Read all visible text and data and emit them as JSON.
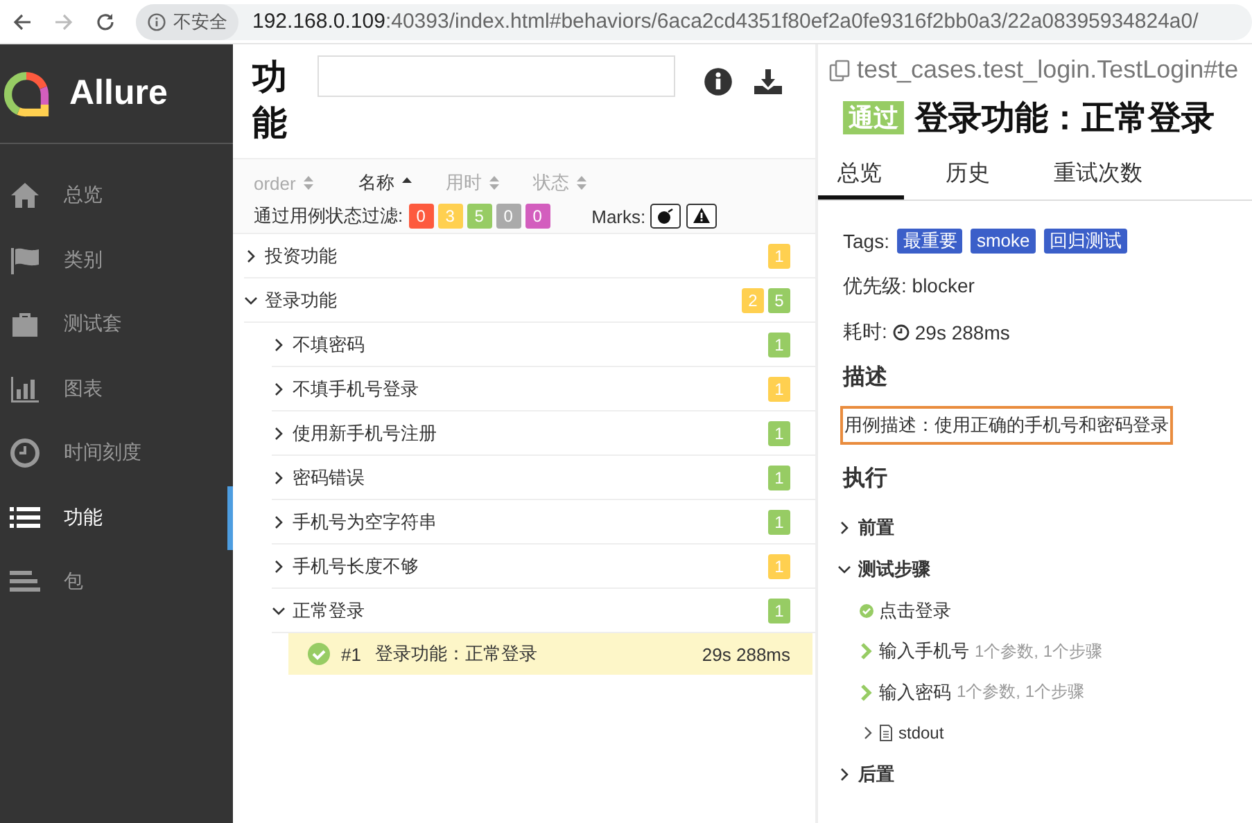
{
  "browser": {
    "security": "不安全",
    "url_host": "192.168.0.109",
    "url_rest": ":40393/index.html#behaviors/6aca2cd4351f80ef2a0fe9316f2bb0a3/22a08395934824a0/"
  },
  "sidebar": {
    "logo": "Allure",
    "items": [
      {
        "kind": "home",
        "label": "总览",
        "selected": false
      },
      {
        "kind": "flag",
        "label": "类别",
        "selected": false
      },
      {
        "kind": "briefcase",
        "label": "测试套",
        "selected": false
      },
      {
        "kind": "chart",
        "label": "图表",
        "selected": false
      },
      {
        "kind": "clock",
        "label": "时间刻度",
        "selected": false
      },
      {
        "kind": "list",
        "label": "功能",
        "selected": true
      },
      {
        "kind": "package",
        "label": "包",
        "selected": false
      }
    ]
  },
  "tree_panel": {
    "title": "功能",
    "sort_columns": [
      {
        "label": "order",
        "selected": false
      },
      {
        "label": "名称",
        "selected": true
      },
      {
        "label": "用时",
        "selected": false
      },
      {
        "label": "状态",
        "selected": false
      }
    ],
    "filter_label": "通过用例状态过滤:",
    "status_counts": [
      {
        "value": "0",
        "color": "#fd5a3e"
      },
      {
        "value": "3",
        "color": "#ffd050"
      },
      {
        "value": "5",
        "color": "#97cc64"
      },
      {
        "value": "0",
        "color": "#aaaaaa"
      },
      {
        "value": "0",
        "color": "#d35ebe"
      }
    ],
    "marks_label": "Marks:",
    "groups": [
      {
        "kind": "group",
        "label": "投资功能",
        "expanded": false,
        "counts": [
          {
            "value": "1",
            "color": "#ffd050"
          }
        ]
      },
      {
        "kind": "group",
        "label": "登录功能",
        "expanded": true,
        "counts": [
          {
            "value": "2",
            "color": "#ffd050"
          },
          {
            "value": "5",
            "color": "#97cc64"
          }
        ],
        "children": [
          {
            "kind": "group",
            "label": "不填密码",
            "expanded": false,
            "counts": [
              {
                "value": "1",
                "color": "#97cc64"
              }
            ]
          },
          {
            "kind": "group",
            "label": "不填手机号登录",
            "expanded": false,
            "counts": [
              {
                "value": "1",
                "color": "#ffd050"
              }
            ]
          },
          {
            "kind": "group",
            "label": "使用新手机号注册",
            "expanded": false,
            "counts": [
              {
                "value": "1",
                "color": "#97cc64"
              }
            ]
          },
          {
            "kind": "group",
            "label": "密码错误",
            "expanded": false,
            "counts": [
              {
                "value": "1",
                "color": "#97cc64"
              }
            ]
          },
          {
            "kind": "group",
            "label": "手机号为空字符串",
            "expanded": false,
            "counts": [
              {
                "value": "1",
                "color": "#97cc64"
              }
            ]
          },
          {
            "kind": "group",
            "label": "手机号长度不够",
            "expanded": false,
            "counts": [
              {
                "value": "1",
                "color": "#ffd050"
              }
            ]
          },
          {
            "kind": "group",
            "label": "正常登录",
            "expanded": true,
            "counts": [
              {
                "value": "1",
                "color": "#97cc64"
              }
            ],
            "children": [
              {
                "kind": "test",
                "number": "#1",
                "label": "登录功能：正常登录",
                "duration": "29s 288ms",
                "selected": true
              }
            ]
          }
        ]
      }
    ]
  },
  "detail": {
    "path": "test_cases.test_login.TestLogin#te",
    "status": "通过",
    "title": "登录功能：正常登录",
    "tabs": [
      {
        "label": "总览",
        "selected": true
      },
      {
        "label": "历史",
        "selected": false
      },
      {
        "label": "重试次数",
        "selected": false
      }
    ],
    "tags_label": "Tags:",
    "tags": [
      "最重要",
      "smoke",
      "回归测试"
    ],
    "priority": "优先级: blocker",
    "duration_label": "耗时:",
    "duration": "29s 288ms",
    "description_heading": "描述",
    "description": "用例描述：使用正确的手机号和密码登录",
    "execution_heading": "执行",
    "sections": [
      {
        "label": "前置",
        "expanded": false
      },
      {
        "label": "测试步骤",
        "expanded": true,
        "steps": [
          {
            "kind": "step",
            "label": "点击登录",
            "has_children": false
          },
          {
            "kind": "step",
            "label": "输入手机号",
            "meta": "1个参数, 1个步骤",
            "has_children": true
          },
          {
            "kind": "step",
            "label": "输入密码",
            "meta": "1个参数, 1个步骤",
            "has_children": true
          },
          {
            "kind": "attachment",
            "label": "stdout"
          }
        ]
      },
      {
        "label": "后置",
        "expanded": false
      }
    ]
  }
}
